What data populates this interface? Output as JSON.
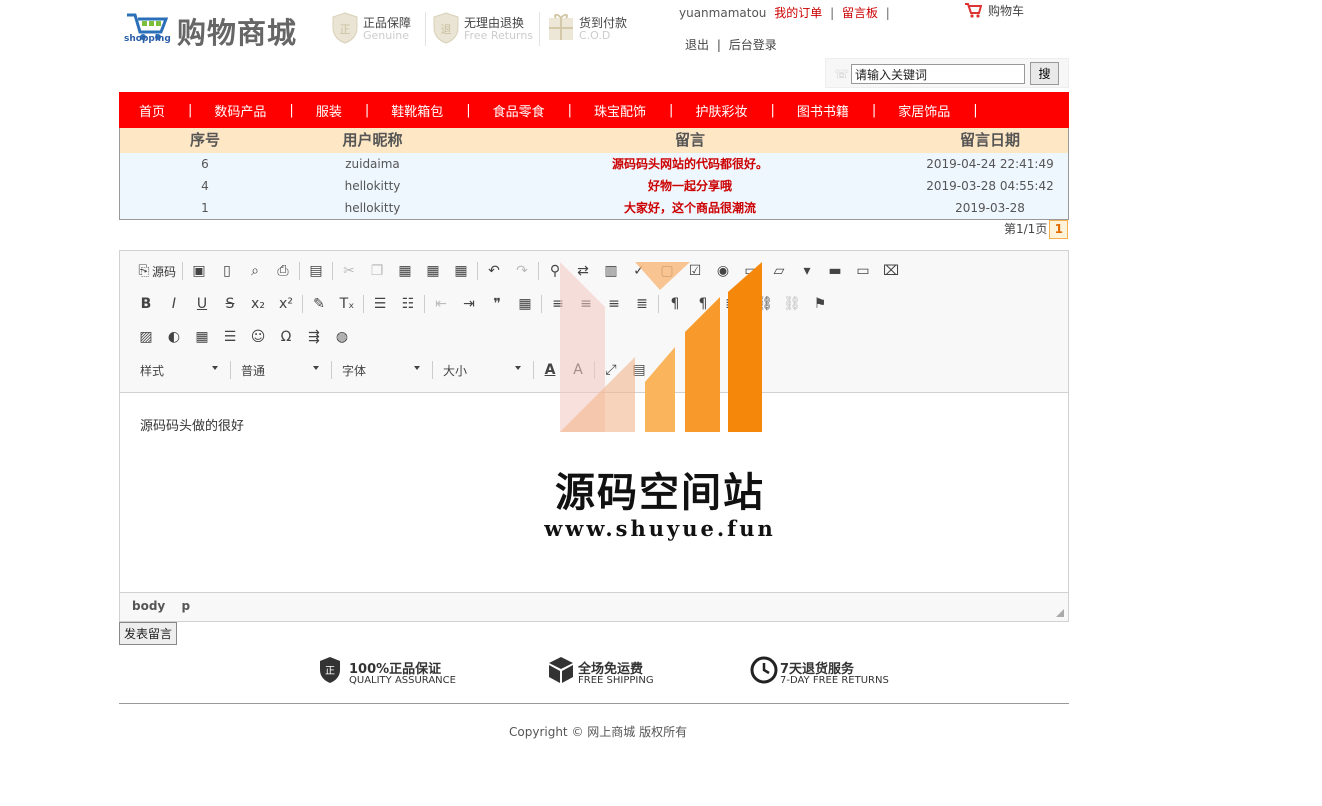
{
  "header": {
    "brand_small": "shopping",
    "brand_title": "购物商城",
    "features": [
      {
        "title": "正品保障",
        "subtitle": "Genuine",
        "icon": "genuine-shield-icon"
      },
      {
        "title": "无理由退换",
        "subtitle": "Free Returns",
        "icon": "returns-shield-icon"
      },
      {
        "title": "货到付款",
        "subtitle": "C.O.D",
        "icon": "cod-gift-icon"
      }
    ],
    "username": "yuanmamatou",
    "my_orders": "我的订单",
    "message_board": "留言板",
    "separator": "|",
    "logout": "退出",
    "admin_login": "后台登录",
    "cart": "购物车",
    "search_value": "请输入关键词",
    "search_button": "搜"
  },
  "nav": [
    "首页",
    "数码产品",
    "服装",
    "鞋靴箱包",
    "食品零食",
    "珠宝配饰",
    "护肤彩妆",
    "图书书籍",
    "家居饰品"
  ],
  "messages": {
    "columns": [
      "序号",
      "用户昵称",
      "留言",
      "留言日期"
    ],
    "rows": [
      {
        "id": "6",
        "nick": "zuidaima",
        "content": "源码码头网站的代码都很好。",
        "date": "2019-04-24 22:41:49"
      },
      {
        "id": "4",
        "nick": "hellokitty",
        "content": "好物一起分享哦",
        "date": "2019-03-28 04:55:42"
      },
      {
        "id": "1",
        "nick": "hellokitty",
        "content": "大家好，这个商品很潮流",
        "date": "2019-03-28"
      }
    ]
  },
  "pager": {
    "label": "第1/1页",
    "current": "1"
  },
  "editor": {
    "source_label": "源码",
    "combos": [
      "样式",
      "普通",
      "字体",
      "大小"
    ],
    "content": "源码码头做的很好",
    "path": [
      "body",
      "p"
    ]
  },
  "submit_label": "发表留言",
  "guarantees": [
    {
      "title": "100%正品保证",
      "subtitle": "QUALITY ASSURANCE"
    },
    {
      "title": "全场免运费",
      "subtitle": "FREE SHIPPING"
    },
    {
      "title": "7天退货服务",
      "subtitle": "7-DAY FREE RETURNS"
    }
  ],
  "copyright": "Copyright © 网上商城 版权所有",
  "watermark": {
    "title": "源码空间站",
    "url": "www.shuyue.fun"
  },
  "colors": {
    "nav_bg": "#ff0000",
    "accent_red": "#cc0000",
    "table_head": "#fde7c5",
    "table_body": "#eef6fe",
    "watermark_orange": "#f7931e"
  }
}
